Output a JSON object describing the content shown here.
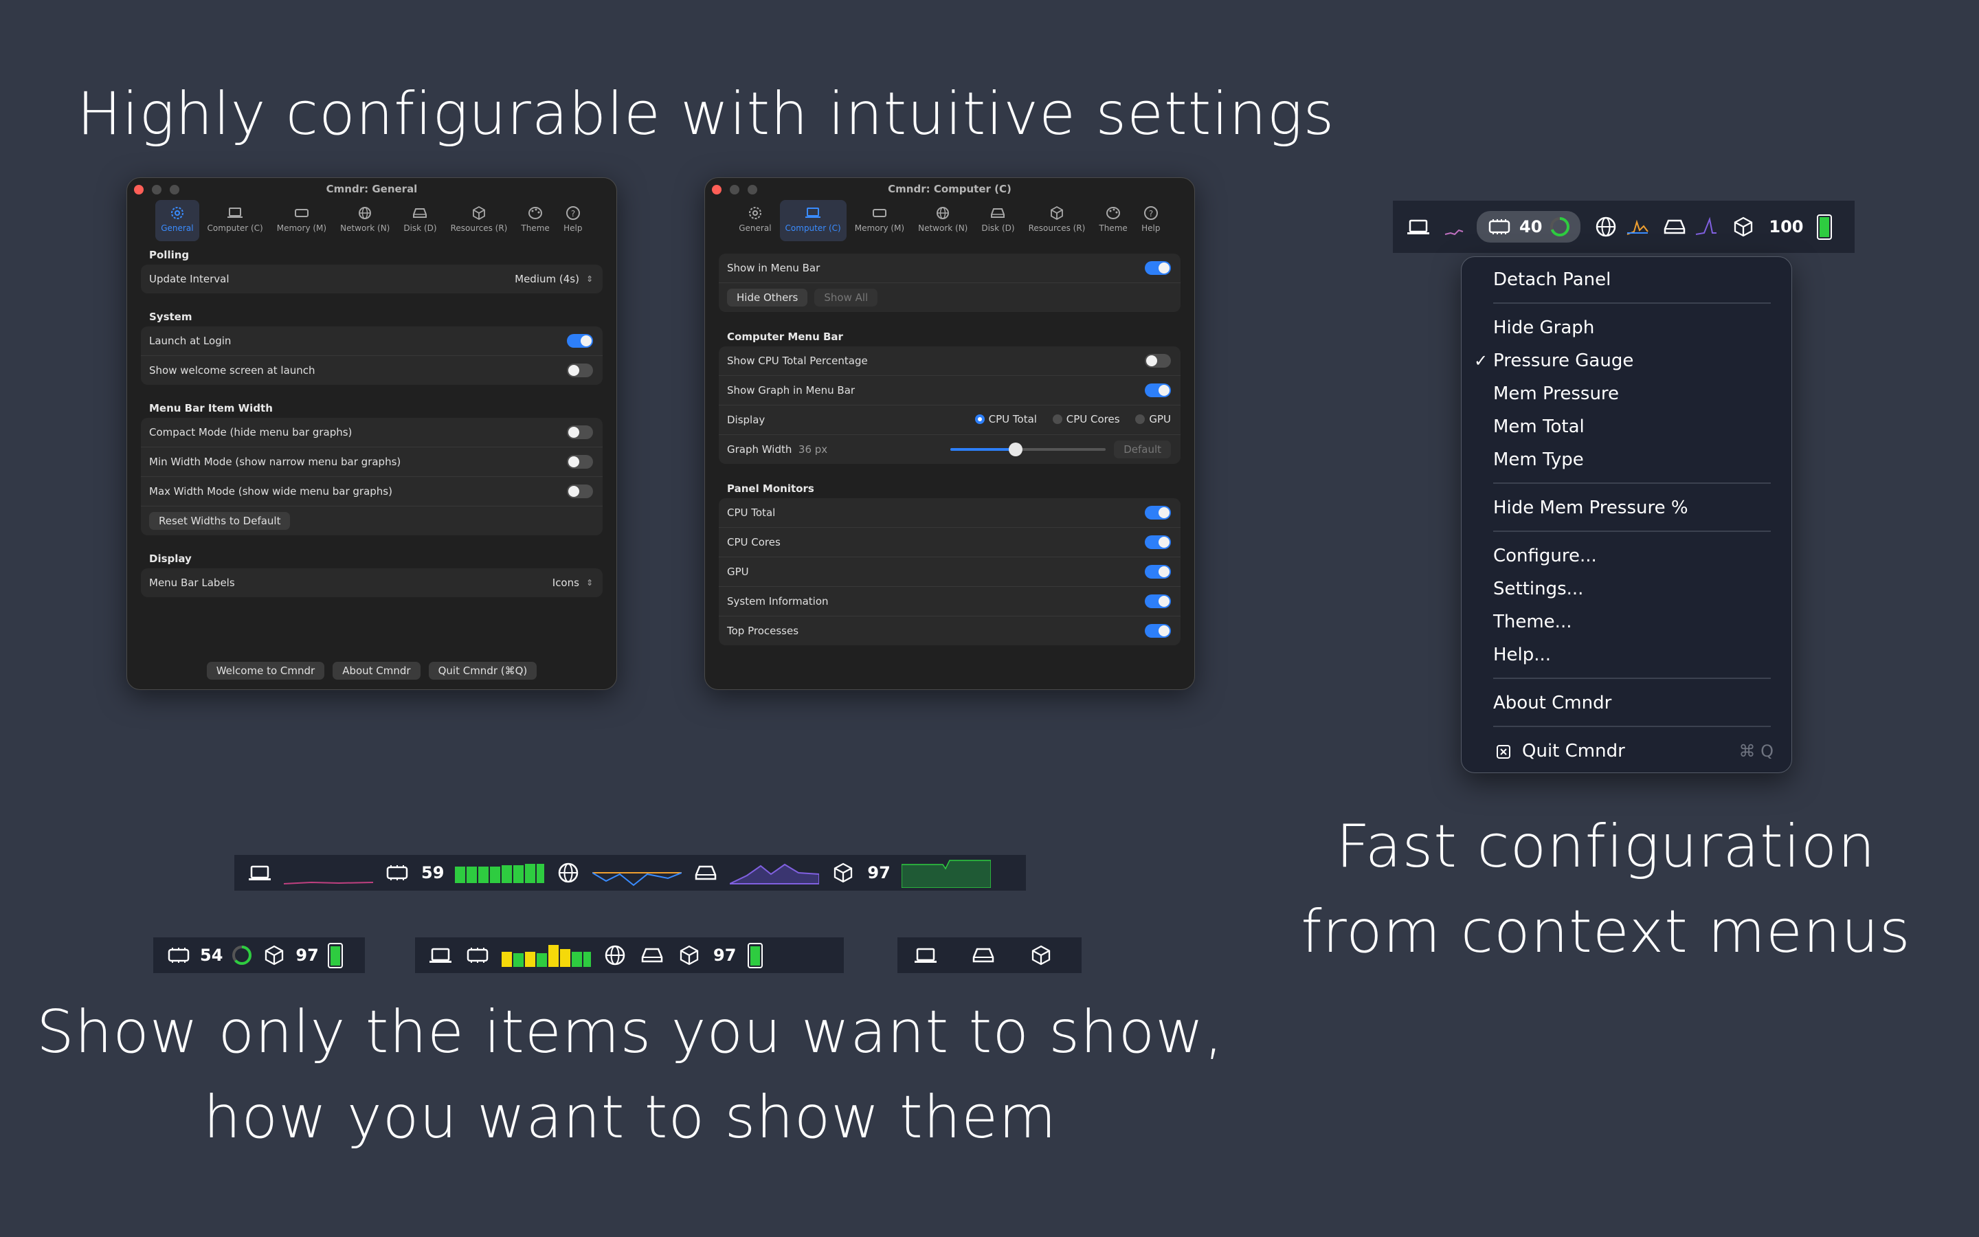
{
  "headlines": {
    "configurable": "Highly configurable with intuitive settings",
    "show_items_line1": "Show only the items you want to show,",
    "show_items_line2": "how you want to show them",
    "fast_config_line1": "Fast configuration",
    "fast_config_line2": "from context menus"
  },
  "tabs": [
    "General",
    "Computer (C)",
    "Memory (M)",
    "Network (N)",
    "Disk (D)",
    "Resources (R)",
    "Theme",
    "Help"
  ],
  "window_general": {
    "title": "Cmndr: General",
    "active_tab": "General",
    "polling": {
      "heading": "Polling",
      "update_interval_label": "Update Interval",
      "update_interval_value": "Medium (4s)"
    },
    "system": {
      "heading": "System",
      "launch_at_login": "Launch at Login",
      "launch_at_login_on": true,
      "welcome_screen": "Show welcome screen at launch",
      "welcome_screen_on": false
    },
    "width": {
      "heading": "Menu Bar Item Width",
      "compact": "Compact Mode (hide menu bar graphs)",
      "min": "Min Width Mode (show narrow menu bar graphs)",
      "max": "Max Width Mode (show wide menu bar graphs)",
      "reset_button": "Reset Widths to Default"
    },
    "display": {
      "heading": "Display",
      "labels_label": "Menu Bar Labels",
      "labels_value": "Icons"
    },
    "footer": {
      "welcome": "Welcome to Cmndr",
      "about": "About Cmndr",
      "quit": "Quit Cmndr (⌘Q)"
    }
  },
  "window_computer": {
    "title": "Cmndr: Computer (C)",
    "active_tab": "Computer (C)",
    "show_in_menu_bar": "Show in Menu Bar",
    "hide_others": "Hide Others",
    "show_all": "Show All",
    "menu_bar": {
      "heading": "Computer Menu Bar",
      "cpu_pct": "Show CPU Total Percentage",
      "graph": "Show Graph in Menu Bar",
      "display_label": "Display",
      "display_options": [
        "CPU Total",
        "CPU Cores",
        "GPU"
      ],
      "display_selected": "CPU Total",
      "graph_width_label": "Graph Width",
      "graph_width_value": "36 px",
      "graph_width_fraction": 0.42,
      "default_button": "Default"
    },
    "panel": {
      "heading": "Panel Monitors",
      "items": [
        "CPU Total",
        "CPU Cores",
        "GPU",
        "System Information",
        "Top Processes"
      ]
    }
  },
  "top_strip": {
    "cpu_value": "40",
    "battery_value": "100"
  },
  "context_menu": {
    "detach": "Detach Panel",
    "hide_graph": "Hide Graph",
    "pressure_gauge": "Pressure Gauge",
    "check_mark": "✓",
    "mem_pressure": "Mem Pressure",
    "mem_total": "Mem Total",
    "mem_type": "Mem Type",
    "hide_mem_pressure": "Hide Mem Pressure %",
    "configure": "Configure...",
    "settings": "Settings...",
    "theme": "Theme...",
    "help": "Help...",
    "about": "About Cmndr",
    "quit": "Quit Cmndr",
    "quit_shortcut": "⌘ Q"
  },
  "strips": {
    "wide_cpu": "59",
    "wide_battery": "97",
    "small1_cpu": "54",
    "small1_battery": "97",
    "small2_battery": "97"
  },
  "colors": {
    "accent": "#2d7ff9",
    "background": "#333947",
    "green": "#2ecc40",
    "yellow": "#f5d90a"
  }
}
